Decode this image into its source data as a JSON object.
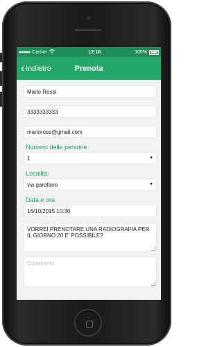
{
  "status_bar": {
    "carrier": "Carrier",
    "time": "12:16",
    "battery": "100%",
    "wifi_icon": "wifi-icon"
  },
  "nav": {
    "back_label": "Indietro",
    "title": "Prenota",
    "color": "#23a86a"
  },
  "form": {
    "name": "Mario Rossi",
    "phone": "3333333333",
    "email": "marioross@gmail.com",
    "people_label": "Numero delle persone",
    "people_value": "1",
    "location_label": "Località:",
    "location_value": "via garofano",
    "datetime_label": "Data e ora",
    "datetime_value": "16/10/2015 10:30",
    "message": "VORREI PRENOTARE UNA RADIOGRAFIA PER IL GIORNO 20 E' POSSIBILE?",
    "comment_placeholder": "Commento"
  }
}
